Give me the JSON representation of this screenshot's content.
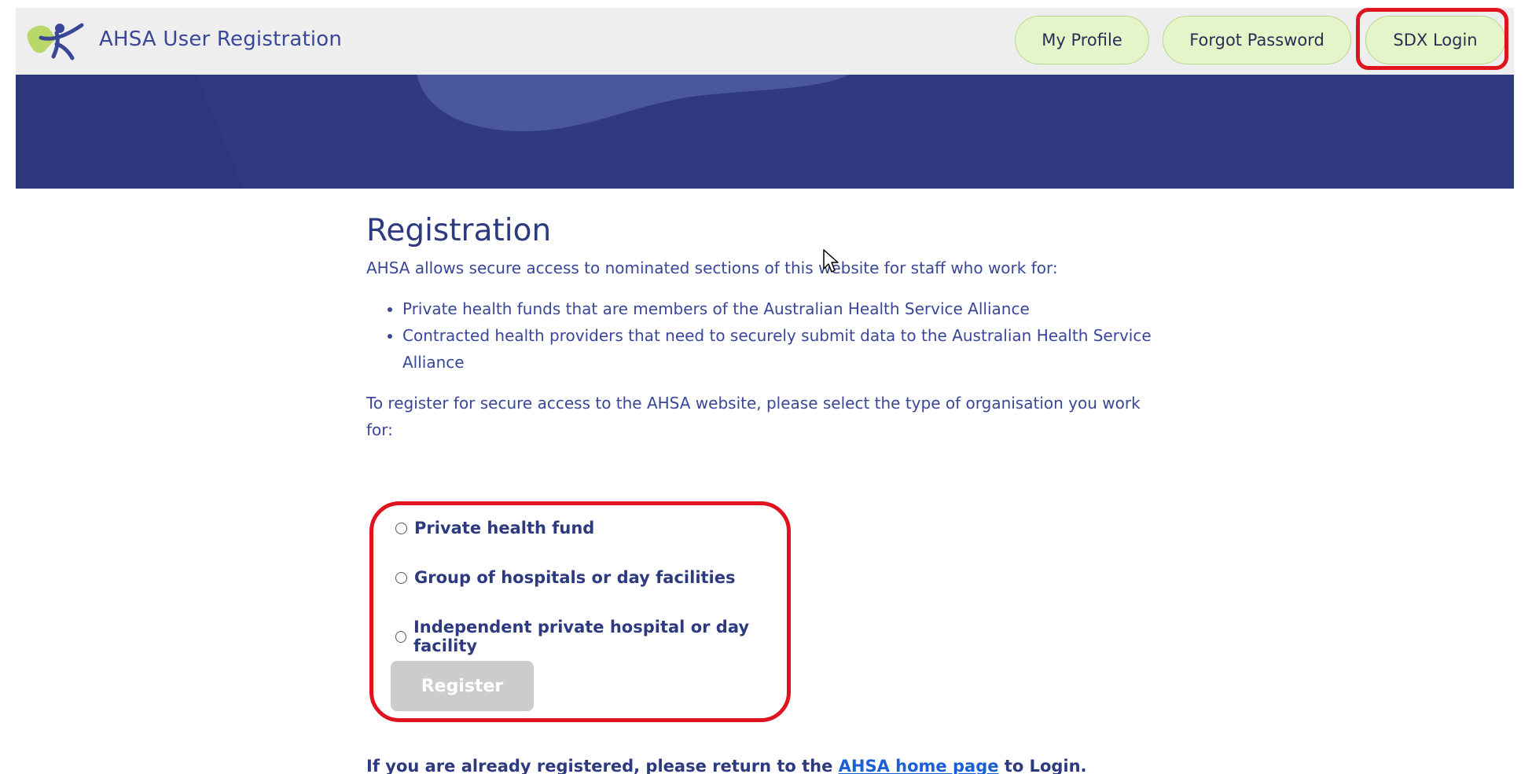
{
  "header": {
    "app_title": "AHSA User Registration",
    "nav": {
      "my_profile": "My Profile",
      "forgot_password": "Forgot Password",
      "sdx_login": "SDX Login"
    }
  },
  "main": {
    "heading": "Registration",
    "intro": "AHSA allows secure access to nominated sections of this website for staff who work for:",
    "bullets": [
      "Private health funds that are members of the Australian Health Service Alliance",
      "Contracted health providers that need to securely submit data to the Australian Health Service Alliance"
    ],
    "instruction": "To register for secure access to the AHSA website, please select the type of organisation you work for:",
    "options": [
      "Private health fund",
      "Group of hospitals or day facilities",
      "Independent private hospital or day facility"
    ],
    "register_label": "Register",
    "footer": {
      "before": "If you are already registered, please return to the ",
      "link": "AHSA home page",
      "after": " to Login."
    }
  },
  "colors": {
    "banner": "#2f3a82",
    "nav_button": "#e6f5c9",
    "highlight": "#e0141e",
    "text": "#2e3a80"
  },
  "icons": {
    "logo": "ahsa-logo-icon",
    "cursor": "mouse-pointer-icon"
  }
}
